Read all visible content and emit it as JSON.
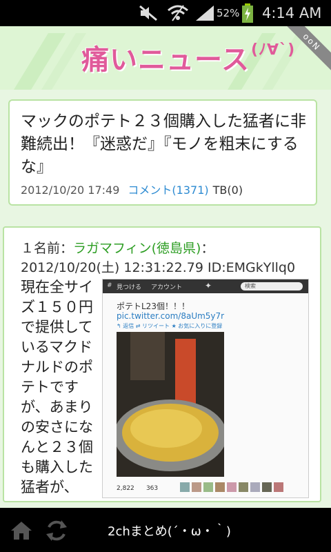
{
  "status_bar": {
    "battery": "52%",
    "time": "4:14 AM"
  },
  "banner": {
    "logo_main": "痛いニュース",
    "logo_sub": "(ﾉ∀`)",
    "ribbon": "ooN"
  },
  "article": {
    "title": "マックのポテト２３個購入した猛者に非難続出！『迷惑だ』『モノを粗末にするな』",
    "date": "2012/10/20 17:49",
    "comments": "コメント(1371)",
    "tb": "TB(0)"
  },
  "post": {
    "number_label": "１名前：",
    "poster": "ラガマフィン(徳島県)",
    "meta": "：2012/10/20(土) 12:31:22.79 ID:EMGkYllq0",
    "body": "現在全サイズ１５０円で提供しているマクドナルドのポテトですが、あまりの安さになんと２３個も購入した猛者が、"
  },
  "tweet": {
    "bar_find": "見つける",
    "bar_account": "アカウント",
    "search_placeholder": "検索",
    "text": "ポテトL23個！！！",
    "link": "pic.twitter.com/8aUm5y7r",
    "actions": "↰ 返信   ⇄ リツイート   ★ お気に入りに登録",
    "retweets": "2,822",
    "favorites": "363"
  },
  "bottom_bar": {
    "title": "2chまとめ(´・ω・｀)"
  },
  "colors": {
    "accent_green": "#2e9e24",
    "link_blue": "#2d8bd2",
    "card_border": "#b9e3a3",
    "logo_pink": "#e05a9a"
  }
}
